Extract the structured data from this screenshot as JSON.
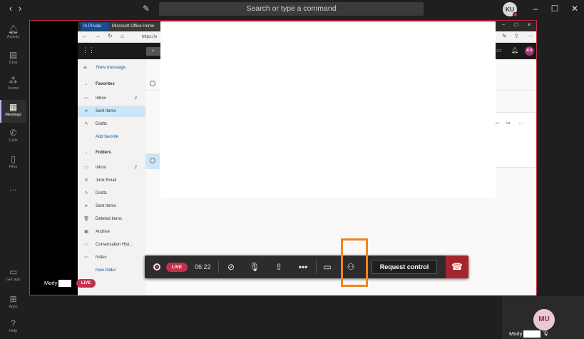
{
  "topbar": {
    "search_placeholder": "Search or type a command",
    "back_label": "‹",
    "forward_label": "›",
    "avatar_initials": "KU"
  },
  "rail": {
    "items": [
      {
        "label": "Activity",
        "icon": "bell-icon"
      },
      {
        "label": "Chat",
        "icon": "chat-icon"
      },
      {
        "label": "Teams",
        "icon": "teams-icon"
      },
      {
        "label": "Meetings",
        "icon": "calendar-icon",
        "active": true
      },
      {
        "label": "Calls",
        "icon": "phone-icon"
      },
      {
        "label": "Files",
        "icon": "file-icon"
      },
      {
        "label": "...",
        "icon": "more-icon"
      },
      {
        "label": "Get app",
        "icon": "device-icon"
      },
      {
        "label": "Apps",
        "icon": "apps-icon"
      },
      {
        "label": "Help",
        "icon": "help-icon"
      }
    ]
  },
  "browser": {
    "tab1": "In Private",
    "tab2": "Microsoft Office Home",
    "url": "https://o",
    "owa_avatar": "KU"
  },
  "mail": {
    "new_message": "New message",
    "favorites_header": "Favorites",
    "favorites": [
      {
        "label": "Inbox",
        "count": "2"
      },
      {
        "label": "Sent Items",
        "count": ""
      },
      {
        "label": "Drafts",
        "count": ""
      },
      {
        "label": "Add favorite",
        "count": ""
      }
    ],
    "folders_header": "Folders",
    "folders": [
      {
        "label": "Inbox",
        "count": "2"
      },
      {
        "label": "Junk Email",
        "count": ""
      },
      {
        "label": "Drafts",
        "count": ""
      },
      {
        "label": "Sent Items",
        "count": ""
      },
      {
        "label": "Deleted Items",
        "count": ""
      },
      {
        "label": "Archive",
        "count": ""
      },
      {
        "label": "Conversation Hist...",
        "count": ""
      },
      {
        "label": "Notes",
        "count": ""
      },
      {
        "label": "New folder",
        "count": ""
      }
    ]
  },
  "controls": {
    "live_badge": "LIVE",
    "timer": "06:22",
    "request_control": "Request control"
  },
  "participant": {
    "name": "Morly",
    "live_badge": "LIVE"
  },
  "self": {
    "initials": "MU",
    "name": "Morly"
  },
  "colors": {
    "accent_red": "#c4314b",
    "highlight": "#f0851e",
    "rail_active": "#b9b9f3"
  }
}
